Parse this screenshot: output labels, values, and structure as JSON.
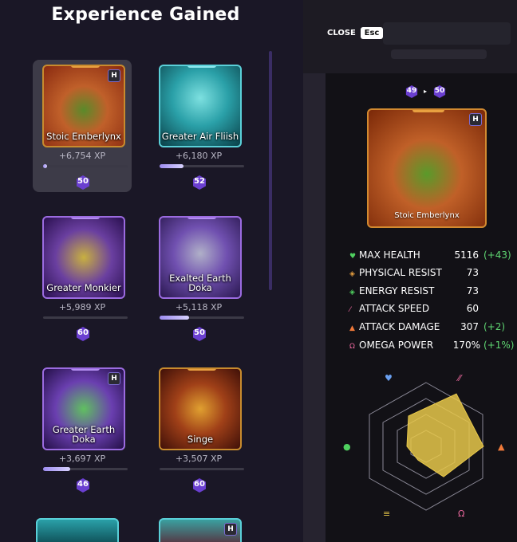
{
  "title": "Experience Gained",
  "cards": [
    {
      "name": "Stoic Emberlynx",
      "xp": "+6,754 XP",
      "level": "50",
      "progress": 0.04,
      "tier": "orange",
      "badge": "H",
      "selected": true
    },
    {
      "name": "Greater Air Fliish",
      "xp": "+6,180 XP",
      "level": "52",
      "progress": 0.28,
      "tier": "teal",
      "badge": ""
    },
    {
      "name": "Greater Monkier",
      "xp": "+5,989 XP",
      "level": "60",
      "progress": 0,
      "tier": "purple",
      "badge": ""
    },
    {
      "name": "Exalted Earth Doka",
      "xp": "+5,118 XP",
      "level": "50",
      "progress": 0.35,
      "tier": "purple",
      "badge": ""
    },
    {
      "name": "Greater Earth Doka",
      "xp": "+3,697 XP",
      "level": "46",
      "progress": 0.32,
      "tier": "purple",
      "badge": "H"
    },
    {
      "name": "Singe",
      "xp": "+3,507 XP",
      "level": "60",
      "progress": 0,
      "tier": "orange",
      "badge": ""
    }
  ],
  "header": {
    "close_label": "CLOSE",
    "esc_label": "Esc"
  },
  "detail": {
    "level_from": "49",
    "level_to": "50",
    "name": "Stoic Emberlynx",
    "badge": "H",
    "stats": [
      {
        "label": "MAX HEALTH",
        "value": "5116",
        "bonus": "(+43)",
        "icon": "heart-icon",
        "color": "#4fd05f"
      },
      {
        "label": "PHYSICAL RESIST",
        "value": "73",
        "bonus": "",
        "icon": "shield-icon",
        "color": "#e8a040"
      },
      {
        "label": "ENERGY RESIST",
        "value": "73",
        "bonus": "",
        "icon": "energy-shield-icon",
        "color": "#4fd05f"
      },
      {
        "label": "ATTACK SPEED",
        "value": "60",
        "bonus": "",
        "icon": "claw-icon",
        "color": "#f06aa0"
      },
      {
        "label": "ATTACK DAMAGE",
        "value": "307",
        "bonus": "(+2)",
        "icon": "flame-icon",
        "color": "#f07a3a"
      },
      {
        "label": "OMEGA POWER",
        "value": "170%",
        "bonus": "(+1%)",
        "icon": "omega-icon",
        "color": "#f06aa0"
      }
    ],
    "radar": {
      "max_health": 0.55,
      "attack_speed": 0.95,
      "attack_damage": 0.9,
      "omega_power": 0.55,
      "energy_resist": 0.25,
      "physical_resist": 0.3
    }
  }
}
